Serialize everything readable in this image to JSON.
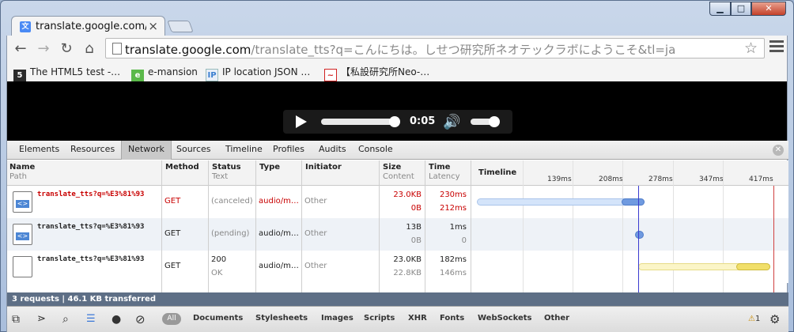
{
  "browser": {
    "tab": {
      "favicon": "translate-favicon",
      "title": "translate.google.com/tr",
      "close_glyph": "×"
    },
    "window_controls": {
      "minimize": "▁",
      "maximize": "□",
      "close": "✕"
    },
    "address": {
      "host": "translate.google.com",
      "path": "/translate_tts?q=こんにちは。しせつ研究所ネオテックラボにようこそ&tl=ja"
    },
    "bookmarks": [
      {
        "icon_text": "5",
        "label": "The HTML5 test -…",
        "color": "#2b2b2b"
      },
      {
        "icon_text": "e",
        "label": "e-mansion",
        "color": "#5bb94a"
      },
      {
        "icon_text": "IP",
        "label": "IP location JSON …",
        "color": "#3b7fd0"
      },
      {
        "icon_text": "~",
        "label": "【私設研究所Neo-…",
        "color": "#d02222"
      }
    ]
  },
  "player": {
    "time": "0:05",
    "progress": 1.0,
    "volume": 0.9
  },
  "devtools": {
    "tabs": [
      "Elements",
      "Resources",
      "Network",
      "Sources",
      "Timeline",
      "Profiles",
      "Audits",
      "Console"
    ],
    "active_tab": "Network",
    "columns": {
      "name": {
        "title": "Name",
        "sub": "Path"
      },
      "method": {
        "title": "Method"
      },
      "status": {
        "title": "Status",
        "sub": "Text"
      },
      "type": {
        "title": "Type"
      },
      "initiator": {
        "title": "Initiator"
      },
      "size": {
        "title": "Size",
        "sub": "Content"
      },
      "time": {
        "title": "Time",
        "sub": "Latency"
      },
      "timeline": {
        "title": "Timeline"
      }
    },
    "ticks": [
      "139ms",
      "208ms",
      "278ms",
      "347ms",
      "417ms"
    ],
    "requests": [
      {
        "name": "translate_tts?q=%E3%81%93",
        "method": "GET",
        "status": "(canceled)",
        "status_text": "",
        "type": "audio/m…",
        "initiator": "Other",
        "size": "23.0KB",
        "content": "0B",
        "time": "230ms",
        "latency": "212ms",
        "error": true
      },
      {
        "name": "translate_tts?q=%E3%81%93",
        "method": "GET",
        "status": "(pending)",
        "status_text": "",
        "type": "audio/m…",
        "initiator": "Other",
        "size": "13B",
        "content": "0B",
        "time": "1ms",
        "latency": "0",
        "error": false
      },
      {
        "name": "translate_tts?q=%E3%81%93",
        "method": "GET",
        "status": "200",
        "status_text": "OK",
        "type": "audio/m…",
        "initiator": "Other",
        "size": "23.0KB",
        "content": "22.8KB",
        "time": "182ms",
        "latency": "146ms",
        "error": false
      }
    ],
    "summary": "3 requests  |  46.1 KB transferred",
    "filters": [
      "All",
      "Documents",
      "Stylesheets",
      "Images",
      "Scripts",
      "XHR",
      "Fonts",
      "WebSockets",
      "Other"
    ],
    "warning_count": "1"
  }
}
